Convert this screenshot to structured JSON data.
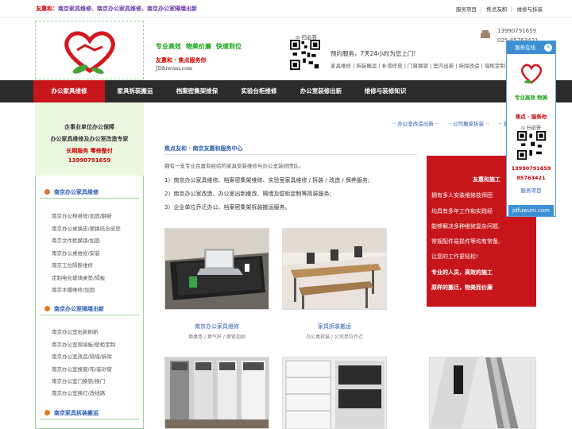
{
  "top": {
    "title_prefix": "友惠和：",
    "title_rest": "南京家具维修、南京办公家具维修、南京办公室隔墙出新",
    "links": [
      "服务项目",
      "焦点友和",
      "维修与拆装"
    ]
  },
  "header": {
    "slogan": [
      "专业高效",
      "物美价廉",
      "快速到位"
    ],
    "brand": "友惠和 · 焦点服务你",
    "domain": "JDfuwuni.com",
    "qr_label": "扫必答",
    "booking": "预约服务，7天24小时为您上门!",
    "services": "家具维修 | 拆装搬运 | 补漆修皮 | 门窗换锁 | 室内出新 | 拆除改造 | 墙柜定制",
    "phone1": "13990791659",
    "phone2": "025-85763421"
  },
  "nav": {
    "items": [
      "办公家具维修",
      "家具拆装搬运",
      "档案密集架维保",
      "实验台柜维修",
      "办公室装修出新",
      "维修与装修知识"
    ],
    "active_index": 0
  },
  "sidebar": {
    "head": [
      "企事业单位办公保障",
      "办公家具维修及办公室改造专家",
      "长期服务  零修整付",
      "13990791659"
    ],
    "sections": [
      {
        "title": "南京办公家具维修",
        "links": [
          "南京办公椅维修/加固/翻新",
          "南京办公桌换皮/更换结合皮垫",
          "南京文件柜换锁/加固",
          "南京办公桌维修/安装",
          "南京工位隔断维修",
          "定制电化玻璃桌垫/隔板",
          "南京木模维修/加固"
        ]
      },
      {
        "title": "南京办公室隔墙出新",
        "links": [
          "南京办公室出新刷新",
          "南京办公室隔墙板/壁柜定制",
          "南京办公室改造/隔墙/拆除",
          "南京办公室换窗/布/装砂窗",
          "南京办公室门换锁/换门",
          "南京办公室换灯/改线路"
        ]
      },
      {
        "title": "南京家具拆装搬运",
        "links": []
      }
    ]
  },
  "main": {
    "sub_links": [
      "·· 办公室改造出新 ··",
      "·· 公司搬家拆装 ··",
      "·· 友"
    ],
    "title": "焦点友和 · 南京友惠和服务中心",
    "intro": "拥有一支专业且富有经验的家具安装维修与办公室装修团队。",
    "points": [
      "1）南京办公家具维修、档案密集架维修、实验室家具维修 / 拆装 / 改造 / 保养服务;",
      "2）南京办公室改造、办公室出新撤改、隔墙及壁柜定制等简装服务;",
      "3）企业单位乔迁办公、档案密集架拆装搬运服务。"
    ],
    "red_box": [
      "友惠和施工",
      "拥有多人安装维修技师团",
      "均具有多年工作和实践经",
      "能够解决多种维修复杂问题,",
      "常规配件易损件等均有常备,",
      "让您的工作更轻松!",
      "专业的人员，高效的施工",
      "原样的搬迁，物美而价廉"
    ],
    "photos": [
      {
        "caption": "南京办公家具维修",
        "sub": "换桌垫 / 换气杆 / 换锁加固"
      },
      {
        "caption": "家具拆装搬运",
        "sub": "办公桌拆装 / 公司单位乔迁"
      }
    ]
  },
  "float": {
    "title": "服务在线",
    "lines": [
      "专业高效 物美",
      "焦点 · 服务你",
      "扫必答",
      "13990791659",
      "85763421",
      "服务项目"
    ],
    "domain": "jdfuwuni.com"
  },
  "colors": {
    "accent_red": "#c7161b",
    "accent_green": "#19a319",
    "accent_blue": "#2a5db0",
    "nav_bg": "#2b2b2b"
  }
}
